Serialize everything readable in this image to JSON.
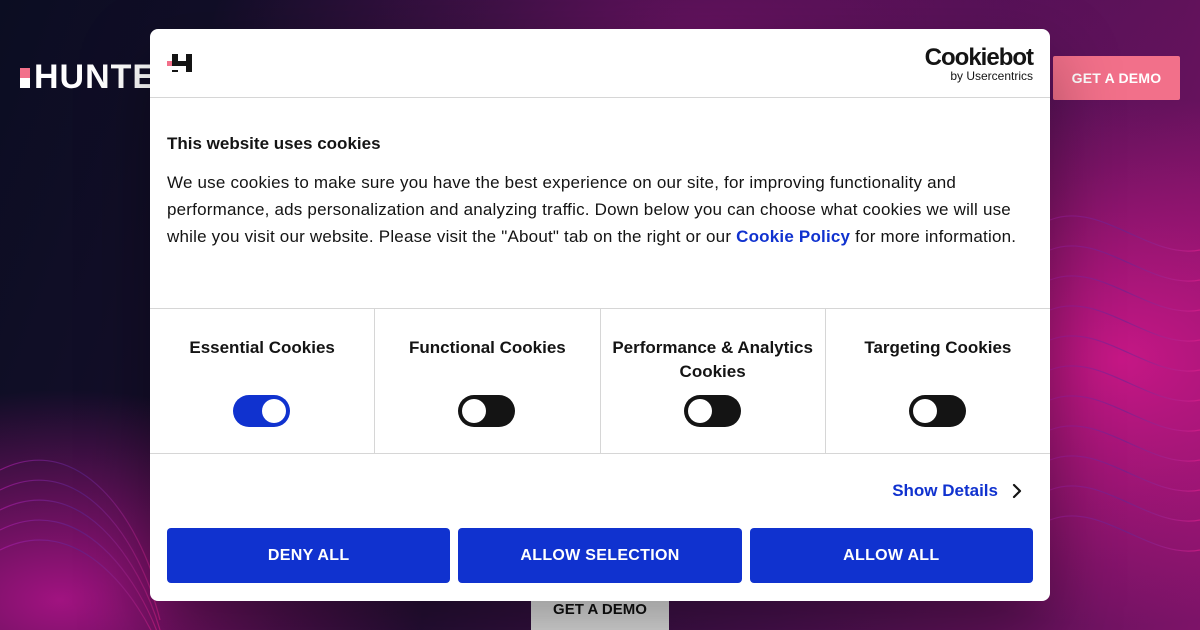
{
  "background": {
    "logo_text": "HUNTE",
    "cta_top_label": "GET A DEMO",
    "cta_bottom_label": "GET A DEMO"
  },
  "dialog": {
    "provider_name": "Cookiebot",
    "provider_by": "by Usercentrics",
    "title": "This website uses cookies",
    "body_text_before_link": "We use cookies to make sure you have the best experience on our site, for improving functionality and performance, ads personalization and analyzing traffic. Down below you can choose what cookies we will use while you visit our website. Please visit the \"About\" tab on the right or our ",
    "link_text": "Cookie Policy",
    "body_text_after_link": " for more information.",
    "categories": [
      {
        "label": "Essential Cookies",
        "enabled": true
      },
      {
        "label": "Functional Cookies",
        "enabled": false
      },
      {
        "label": "Performance & Analytics Cookies",
        "enabled": false
      },
      {
        "label": "Targeting Cookies",
        "enabled": false
      }
    ],
    "show_details_label": "Show Details",
    "buttons": {
      "deny_all": "DENY ALL",
      "allow_selection": "ALLOW SELECTION",
      "allow_all": "ALLOW ALL"
    }
  },
  "colors": {
    "accent_blue": "#1032cf",
    "brand_pink": "#f2708a",
    "toggle_off": "#141414"
  }
}
